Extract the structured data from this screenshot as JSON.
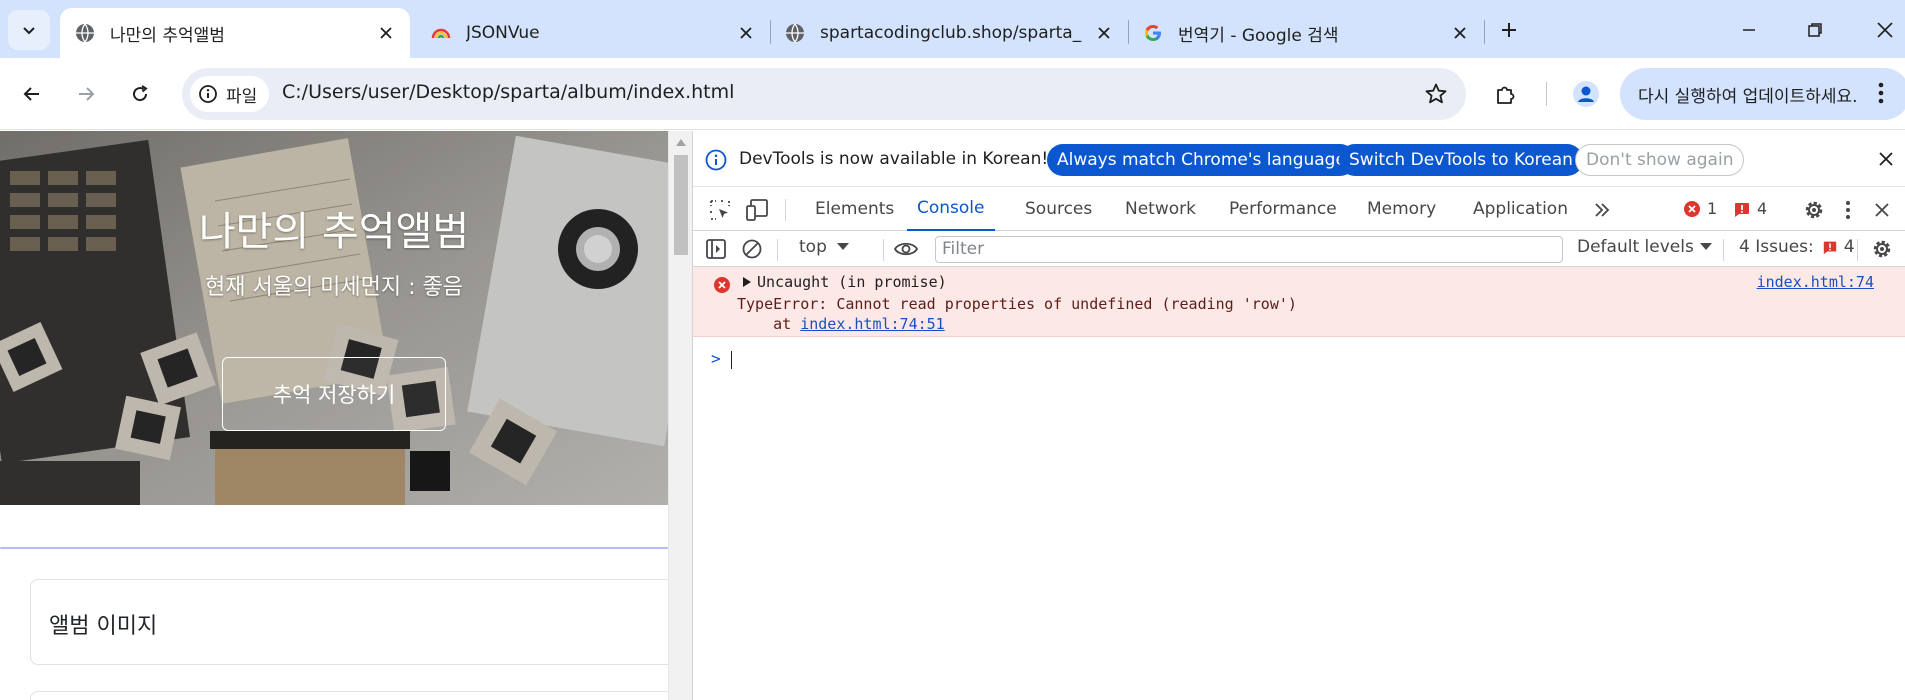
{
  "browser": {
    "tabs": [
      {
        "label": "나만의 추억앨범",
        "active": true
      },
      {
        "label": "JSONVue"
      },
      {
        "label": "spartacodingclub.shop/sparta_"
      },
      {
        "label": "번역기 - Google 검색"
      }
    ],
    "omnibox": {
      "chip_label": "파일",
      "url": "C:/Users/user/Desktop/sparta/album/index.html"
    },
    "update_label": "다시 실행하여 업데이트하세요."
  },
  "page": {
    "hero_title": "나만의 추억앨범",
    "hero_subtitle": "현재 서울의 미세먼지 : 좋음",
    "hero_button": "추억 저장하기",
    "form_label": "앨범 이미지"
  },
  "devtools": {
    "infobar": {
      "message": "DevTools is now available in Korean!",
      "btn_match": "Always match Chrome's language",
      "btn_switch": "Switch DevTools to Korean",
      "btn_dismiss": "Don't show again"
    },
    "tabs": [
      "Elements",
      "Console",
      "Sources",
      "Network",
      "Performance",
      "Memory",
      "Application"
    ],
    "active_tab": "Console",
    "error_count": "1",
    "warning_count": "4",
    "context": "top",
    "filter_placeholder": "Filter",
    "levels": "Default levels",
    "issues_label": "4 Issues:",
    "issues_count": "4",
    "console": {
      "line1": "Uncaught (in promise)",
      "line2": "TypeError: Cannot read properties of undefined (reading 'row')",
      "line3_prefix": "    at ",
      "line3_link": "index.html:74:51",
      "source_link": "index.html:74"
    }
  },
  "colors": {
    "accent": "#0b57d0",
    "tabstrip": "#d3e3fd",
    "error_bg": "#fce8e6",
    "error_icon": "#dc362e"
  }
}
